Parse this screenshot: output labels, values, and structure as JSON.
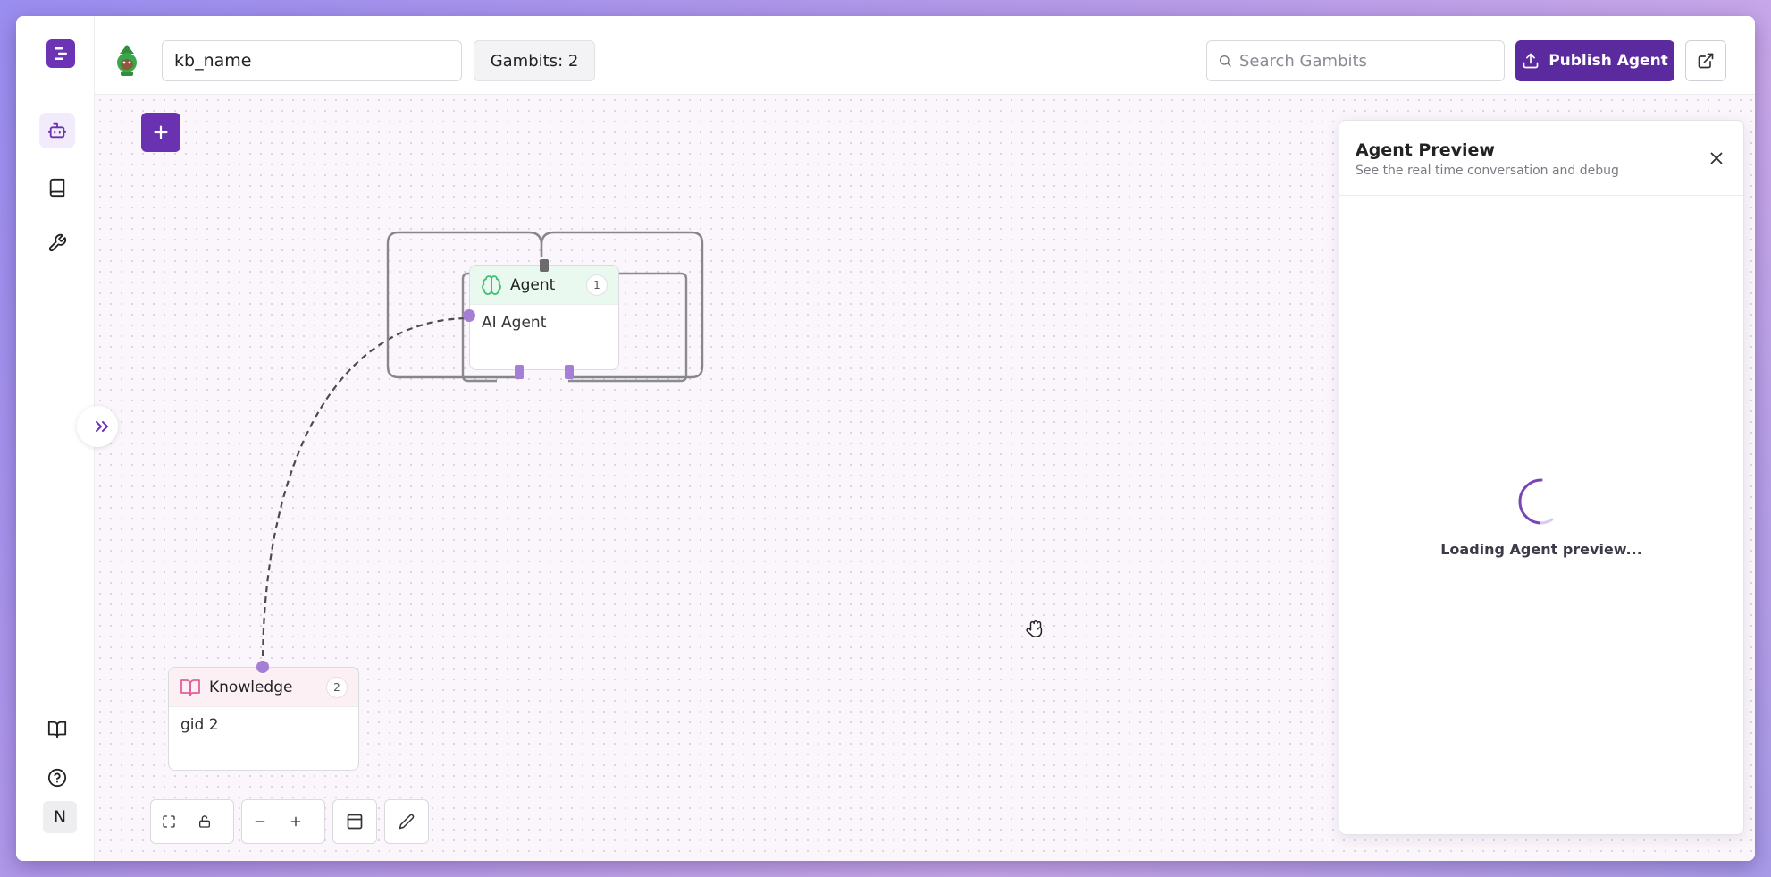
{
  "header": {
    "kb_name_value": "kb_name",
    "gambits_badge": "Gambits: 2",
    "search_placeholder": "Search Gambits",
    "publish_label": "Publish Agent"
  },
  "sidebar": {
    "items": [
      {
        "icon": "bot-icon",
        "active": true
      },
      {
        "icon": "book-icon"
      },
      {
        "icon": "wrench-icon"
      }
    ],
    "bottom": [
      {
        "icon": "book-open-icon"
      },
      {
        "icon": "help-circle-icon"
      },
      {
        "avatar_initial": "N"
      }
    ]
  },
  "nodes": {
    "agent": {
      "title": "Agent",
      "count": "1",
      "label": "AI Agent"
    },
    "knowledge": {
      "title": "Knowledge",
      "count": "2",
      "label": "gid 2"
    }
  },
  "preview": {
    "title": "Agent Preview",
    "subtitle": "See the real time conversation and debug",
    "loading": "Loading Agent preview..."
  },
  "colors": {
    "accent": "#5b2a9e",
    "agent_header": "#e9f9ef",
    "knowledge_header": "#fdf0f5",
    "handle": "#a57fd6"
  }
}
